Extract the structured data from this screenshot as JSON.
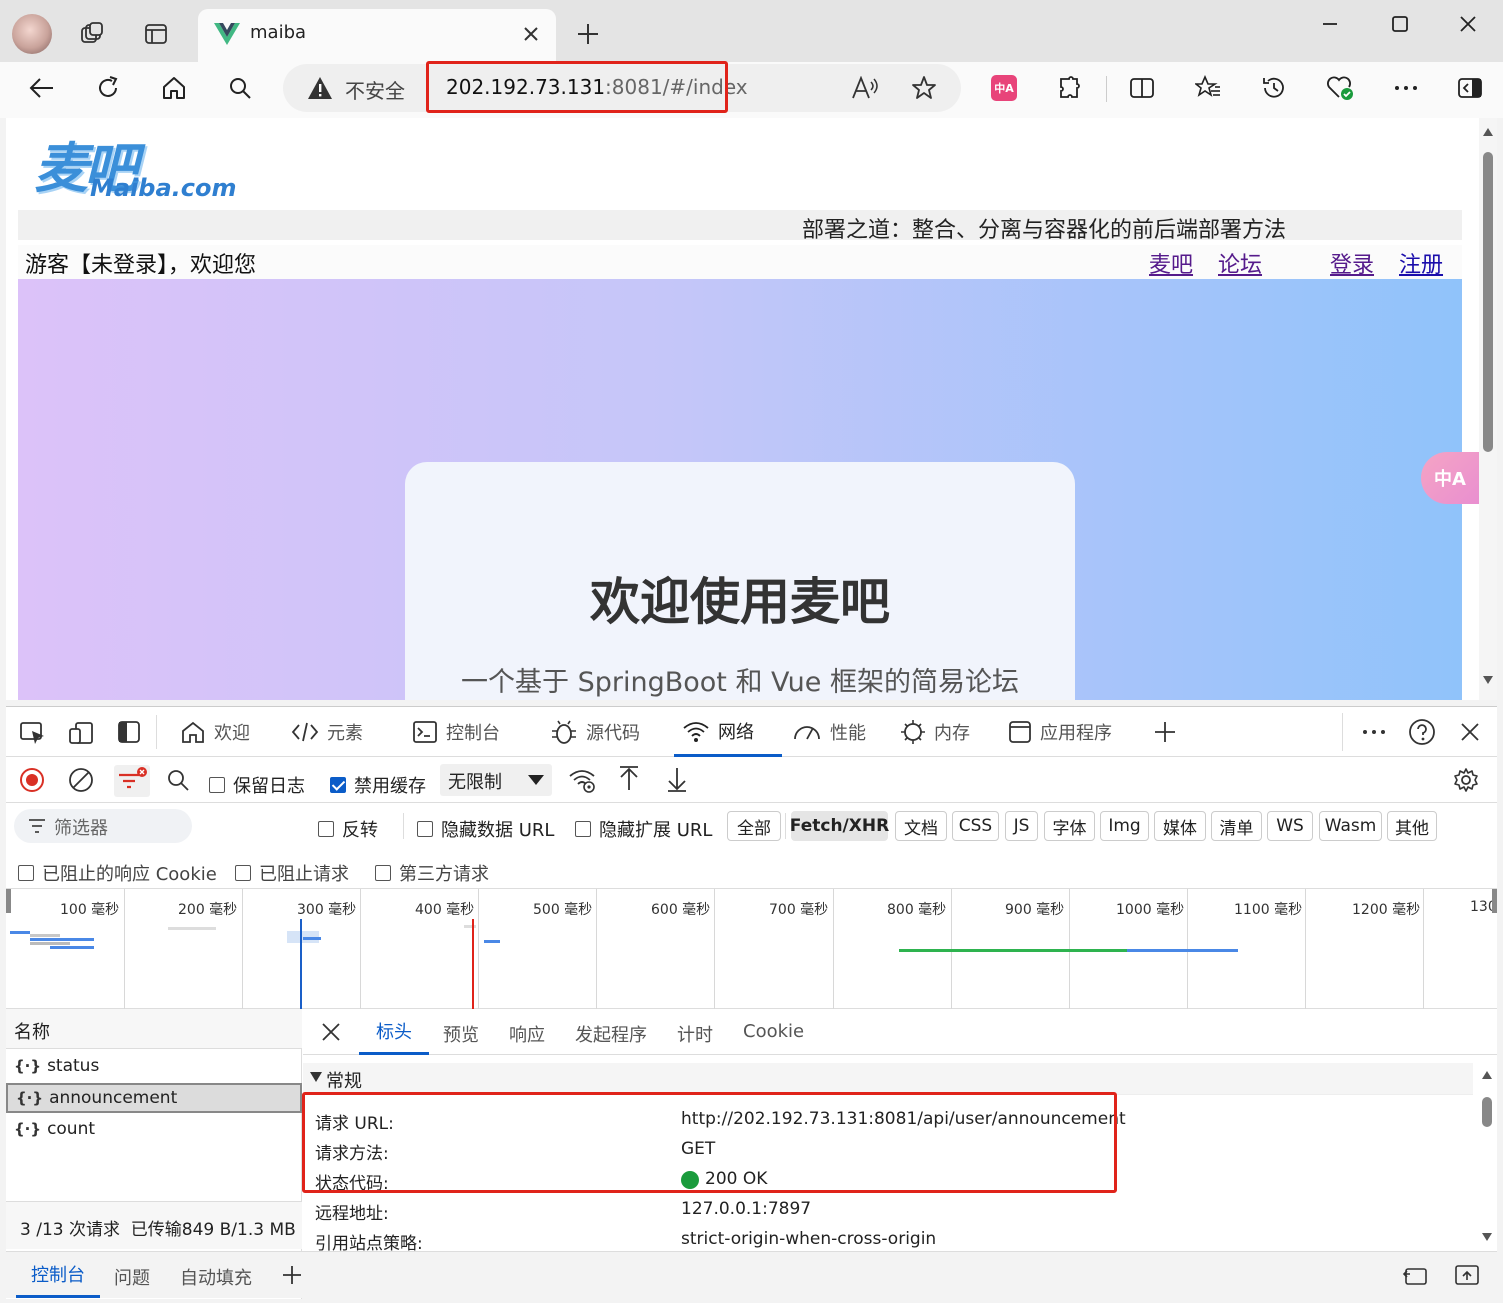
{
  "browser": {
    "tab_title": "maiba",
    "security_label": "不安全",
    "url_host": "202.192.73.131",
    "url_rest": ":8081/#/index"
  },
  "page": {
    "logo_cn": "麦吧",
    "logo_en": "Maiba.com",
    "marquee": "部署之道：整合、分离与容器化的前后端部署方法",
    "greeting": "游客【未登录】，欢迎您",
    "nav_links": [
      "麦吧",
      "论坛",
      "登录",
      "注册"
    ],
    "hero_title": "欢迎使用麦吧",
    "hero_subtitle": "一个基于 SpringBoot 和 Vue 框架的简易论坛",
    "translate_badge": "中A"
  },
  "devtools": {
    "tabs": [
      "欢迎",
      "元素",
      "控制台",
      "源代码",
      "网络",
      "性能",
      "内存",
      "应用程序"
    ],
    "toolbar": {
      "preserve_log": "保留日志",
      "disable_cache": "禁用缓存",
      "throttle": "无限制"
    },
    "filter": {
      "placeholder": "筛选器",
      "invert": "反转",
      "hide_data_url": "隐藏数据 URL",
      "hide_ext_url": "隐藏扩展 URL",
      "types": [
        "全部",
        "Fetch/XHR",
        "文档",
        "CSS",
        "JS",
        "字体",
        "Img",
        "媒体",
        "清单",
        "WS",
        "Wasm",
        "其他"
      ],
      "blocked_cookies": "已阻止的响应 Cookie",
      "blocked_requests": "已阻止请求",
      "third_party": "第三方请求"
    },
    "timeline_ticks": [
      "100 毫秒",
      "200 毫秒",
      "300 毫秒",
      "400 毫秒",
      "500 毫秒",
      "600 毫秒",
      "700 毫秒",
      "800 毫秒",
      "900 毫秒",
      "1000 毫秒",
      "1100 毫秒",
      "1200 毫秒",
      "130"
    ],
    "name_header": "名称",
    "requests": [
      "status",
      "announcement",
      "count"
    ],
    "summary": "3 /13 次请求  已传输849 B/1.3 MB",
    "detail_tabs": [
      "标头",
      "预览",
      "响应",
      "发起程序",
      "计时",
      "Cookie"
    ],
    "general_section": "常规",
    "general": [
      {
        "key": "请求 URL:",
        "value": "http://202.192.73.131:8081/api/user/announcement"
      },
      {
        "key": "请求方法:",
        "value": "GET"
      },
      {
        "key": "状态代码:",
        "value": "200 OK"
      },
      {
        "key": "远程地址:",
        "value": "127.0.0.1:7897"
      },
      {
        "key": "引用站点策略:",
        "value": "strict-origin-when-cross-origin"
      }
    ],
    "drawer_tabs": [
      "控制台",
      "问题",
      "自动填充"
    ]
  },
  "colors": {
    "accent": "#0b5cc8",
    "highlight": "#e0231a",
    "status_ok": "#1a9b3c"
  }
}
